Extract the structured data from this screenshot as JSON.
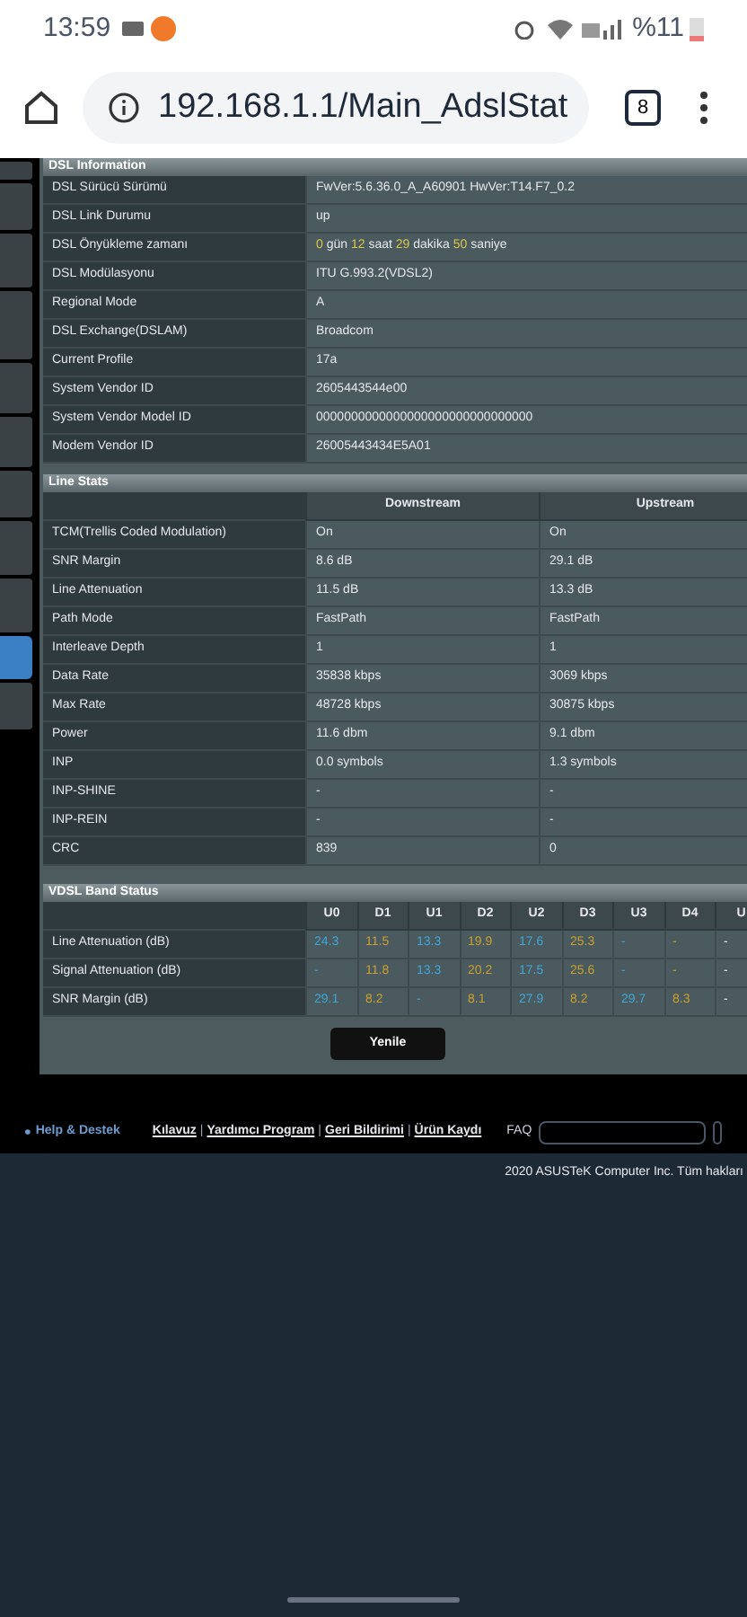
{
  "status_bar": {
    "time": "13:59",
    "battery": "%11"
  },
  "browser": {
    "url": "192.168.1.1/Main_AdslStat",
    "tab_count": "8"
  },
  "sidebar": {
    "items": [
      {
        "selected": false
      },
      {
        "selected": false
      },
      {
        "selected": false
      },
      {
        "selected": false
      },
      {
        "selected": false
      },
      {
        "selected": false
      },
      {
        "selected": false
      },
      {
        "selected": false
      },
      {
        "selected": false
      },
      {
        "selected": true
      },
      {
        "selected": false
      }
    ]
  },
  "dsl_information": {
    "title": "DSL Information",
    "rows": [
      {
        "label": "DSL Sürücü Sürümü",
        "value": "FwVer:5.6.36.0_A_A60901 HwVer:T14.F7_0.2"
      },
      {
        "label": "DSL Link Durumu",
        "value": "up"
      },
      {
        "label": "DSL Önyükleme zamanı",
        "uptime": [
          {
            "value": "0",
            "unit": "gün"
          },
          {
            "value": "12",
            "unit": "saat"
          },
          {
            "value": "29",
            "unit": "dakika"
          },
          {
            "value": "50",
            "unit": "saniye"
          }
        ]
      },
      {
        "label": "DSL Modülasyonu",
        "value": "ITU G.993.2(VDSL2)"
      },
      {
        "label": "Regional Mode",
        "value": "A"
      },
      {
        "label": "DSL Exchange(DSLAM)",
        "value": "Broadcom"
      },
      {
        "label": "Current Profile",
        "value": "17a"
      },
      {
        "label": "System Vendor ID",
        "value": "2605443544e00"
      },
      {
        "label": "System Vendor Model ID",
        "value": "0000000000000000000000000000000"
      },
      {
        "label": "Modem Vendor ID",
        "value": "26005443434E5A01"
      }
    ]
  },
  "line_stats": {
    "title": "Line Stats",
    "columns": [
      "Downstream",
      "Upstream"
    ],
    "rows": [
      {
        "label": "TCM(Trellis Coded Modulation)",
        "values": [
          "On",
          "On"
        ]
      },
      {
        "label": "SNR Margin",
        "values": [
          "8.6 dB",
          "29.1 dB"
        ]
      },
      {
        "label": "Line Attenuation",
        "values": [
          "11.5 dB",
          "13.3 dB"
        ]
      },
      {
        "label": "Path Mode",
        "values": [
          "FastPath",
          "FastPath"
        ]
      },
      {
        "label": "Interleave Depth",
        "values": [
          "1",
          "1"
        ]
      },
      {
        "label": "Data Rate",
        "values": [
          "35838 kbps",
          "3069 kbps"
        ]
      },
      {
        "label": "Max Rate",
        "values": [
          "48728 kbps",
          "30875 kbps"
        ]
      },
      {
        "label": "Power",
        "values": [
          "11.6 dbm",
          "9.1 dbm"
        ]
      },
      {
        "label": "INP",
        "values": [
          "0.0 symbols",
          "1.3 symbols"
        ]
      },
      {
        "label": "INP-SHINE",
        "values": [
          "-",
          "-"
        ]
      },
      {
        "label": "INP-REIN",
        "values": [
          "-",
          "-"
        ]
      },
      {
        "label": "CRC",
        "values": [
          "839",
          "0"
        ]
      }
    ]
  },
  "vdsl_band_status": {
    "title": "VDSL Band Status",
    "columns": [
      {
        "label": "U0",
        "color": "#3fa7d6"
      },
      {
        "label": "D1",
        "color": "#c8a030"
      },
      {
        "label": "U1",
        "color": "#3fa7d6"
      },
      {
        "label": "D2",
        "color": "#c8a030"
      },
      {
        "label": "U2",
        "color": "#3fa7d6"
      },
      {
        "label": "D3",
        "color": "#c8a030"
      },
      {
        "label": "U3",
        "color": "#3fa7d6"
      },
      {
        "label": "D4",
        "color": "#c8a030"
      },
      {
        "label": "U"
      }
    ],
    "rows": [
      {
        "label": "Line Attenuation (dB)",
        "values": [
          "24.3",
          "11.5",
          "13.3",
          "19.9",
          "17.6",
          "25.3",
          "-",
          "-",
          "-"
        ]
      },
      {
        "label": "Signal Attenuation (dB)",
        "values": [
          "-",
          "11.8",
          "13.3",
          "20.2",
          "17.5",
          "25.6",
          "-",
          "-",
          "-"
        ]
      },
      {
        "label": "SNR Margin (dB)",
        "values": [
          "29.1",
          "8.2",
          "-",
          "8.1",
          "27.9",
          "8.2",
          "29.7",
          "8.3",
          "-"
        ]
      }
    ]
  },
  "refresh_button": "Yenile",
  "footer": {
    "help": "Help & Destek",
    "links": [
      "Kılavuz",
      "Yardımcı Program",
      "Geri Bildirimi",
      "Ürün Kaydı"
    ],
    "link_separator": "|",
    "faq_label": "FAQ",
    "copyright": "2020 ASUSTeK Computer Inc. Tüm hakları"
  }
}
